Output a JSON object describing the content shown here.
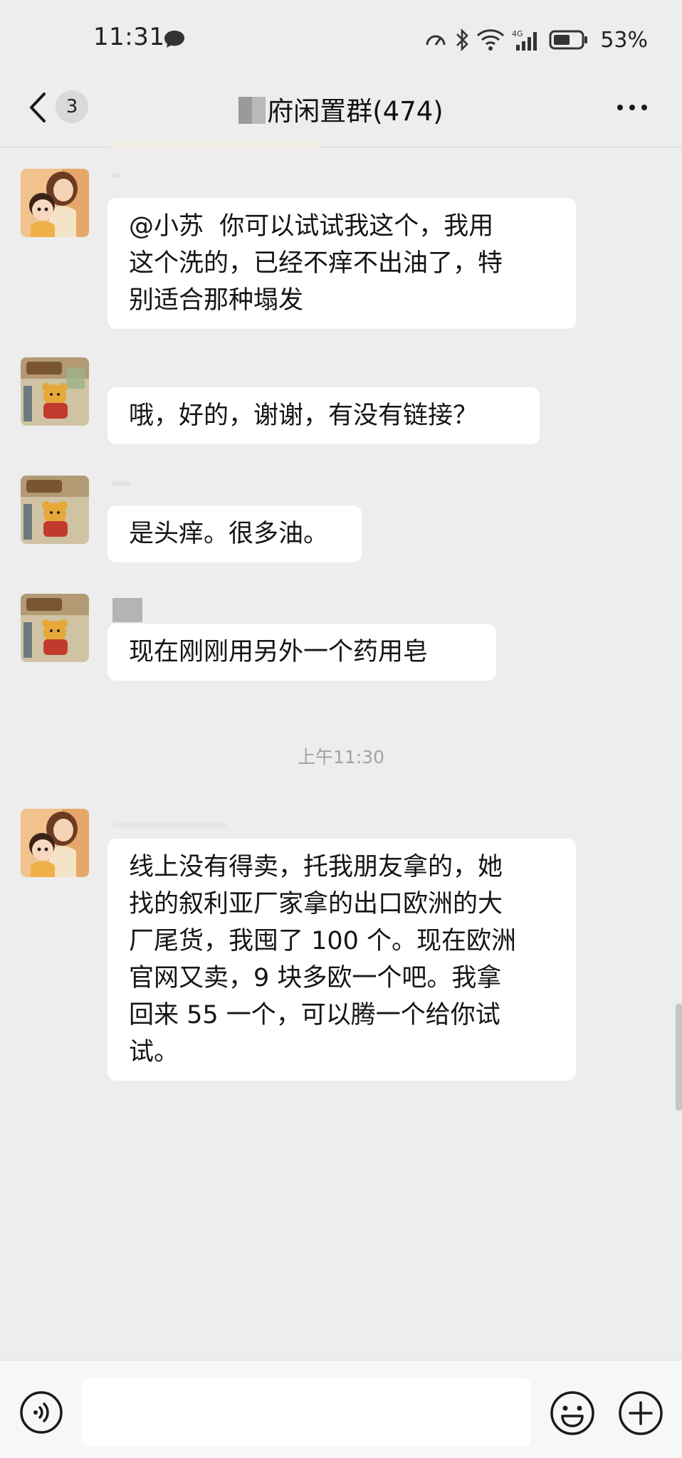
{
  "status_bar": {
    "time": "11:31",
    "battery_text": "53%",
    "network_label": "4G"
  },
  "header": {
    "unread_count": "3",
    "group_name": "府闲置群(474)"
  },
  "messages": [
    {
      "avatar": "mother-and-child-avatar",
      "text": "@小苏  你可以试试我这个，我用\n这个洗的，已经不痒不出油了，特\n别适合那种塌发"
    },
    {
      "avatar": "winnie-the-pooh-avatar",
      "text": "哦，好的，谢谢，有没有链接？"
    },
    {
      "avatar": "winnie-the-pooh-avatar",
      "text": "是头痒。很多油。"
    },
    {
      "avatar": "winnie-the-pooh-avatar",
      "text": "现在刚刚用另外一个药用皂"
    },
    {
      "avatar": "mother-and-child-avatar",
      "text": "线上没有得卖，托我朋友拿的，她\n找的叙利亚厂家拿的出口欧洲的大\n厂尾货，我囤了 100 个。现在欧洲\n官网又卖，9 块多欧一个吧。我拿\n回来 55 一个，可以腾一个给你试\n试。"
    }
  ],
  "timestamp": "上午11:30",
  "input_bar": {
    "placeholder": "",
    "icons": [
      "voice-icon",
      "emoji-icon",
      "plus-icon"
    ]
  }
}
